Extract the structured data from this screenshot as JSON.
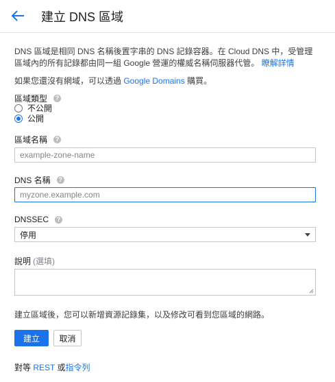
{
  "header": {
    "title": "建立 DNS 區域",
    "back_icon": "arrow-left-icon"
  },
  "intro": {
    "text": "DNS 區域是相同 DNS 名稱後置字串的 DNS 記錄容器。在 Cloud DNS 中，受管理區域內的所有記錄都由同一組 Google 營運的權威名稱伺服器代管。",
    "learn_more": "瞭解詳情"
  },
  "domain_note": {
    "prefix": "如果您還沒有網域，可以透過 ",
    "link": "Google Domains",
    "suffix": " 購買。"
  },
  "zone_type": {
    "label": "區域類型",
    "options": [
      {
        "label": "不公開",
        "selected": false
      },
      {
        "label": "公開",
        "selected": true
      }
    ]
  },
  "zone_name": {
    "label": "區域名稱",
    "placeholder": "example-zone-name",
    "value": ""
  },
  "dns_name": {
    "label": "DNS 名稱",
    "placeholder": "myzone.example.com",
    "value": ""
  },
  "dnssec": {
    "label": "DNSSEC",
    "selected": "停用"
  },
  "description": {
    "label": "說明",
    "optional": "(選填)",
    "value": ""
  },
  "after_note": "建立區域後，您可以新增資源記錄集，以及修改可看到您區域的網路。",
  "actions": {
    "create": "建立",
    "cancel": "取消"
  },
  "equivalent": {
    "prefix": "對等 ",
    "rest": "REST",
    "or": " 或",
    "cli": "指令列"
  },
  "colors": {
    "accent": "#1a73e8",
    "text": "#202124",
    "border": "#c4c4c4"
  }
}
